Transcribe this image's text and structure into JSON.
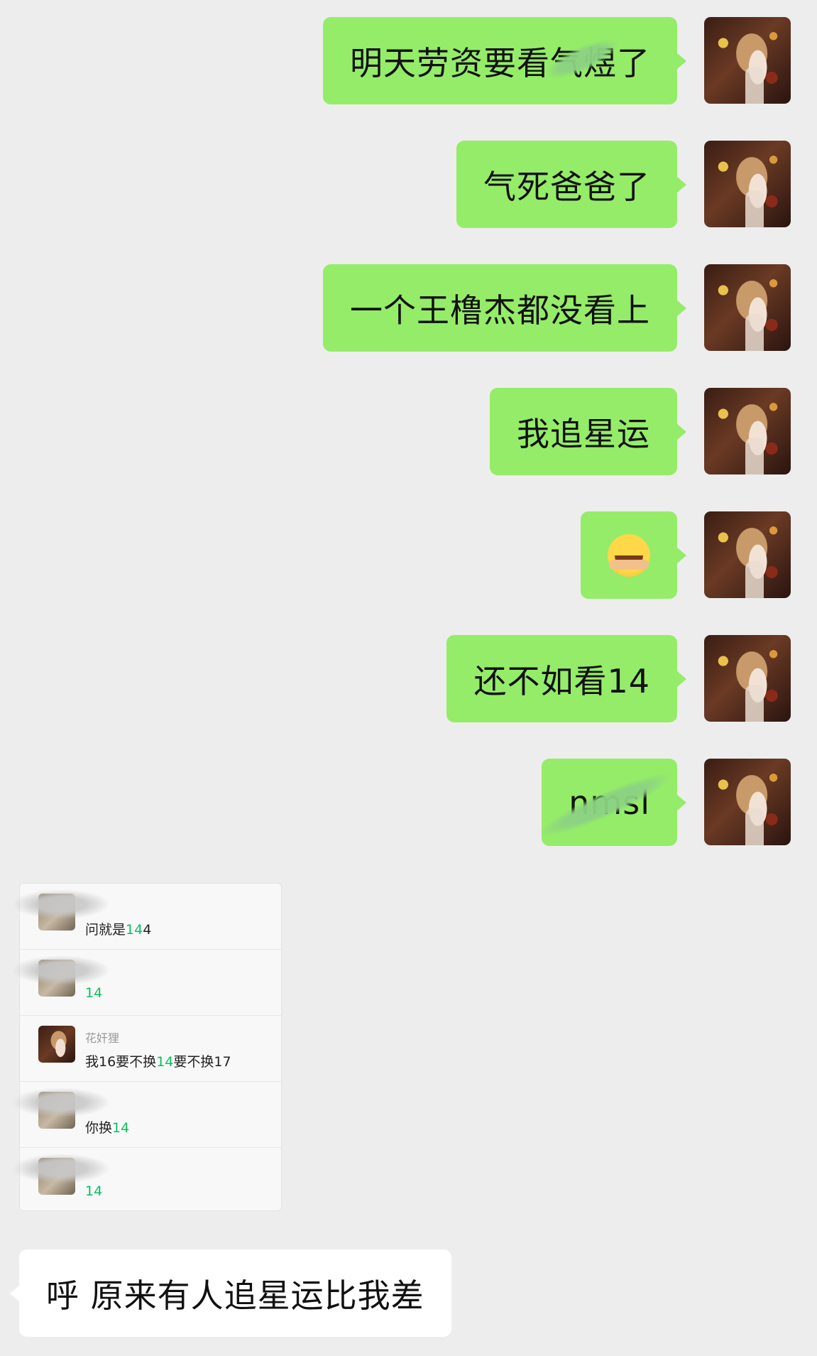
{
  "messages_out": [
    {
      "text": "明天劳资要看气煜了"
    },
    {
      "text": "气死爸爸了"
    },
    {
      "text": "一个王橹杰都没看上"
    },
    {
      "text": "我追星运"
    },
    {
      "text": "",
      "emoji": "crying-laughing-emoji"
    },
    {
      "text": "还不如看14"
    },
    {
      "text": "nmsl"
    }
  ],
  "quote_card": {
    "rows": [
      {
        "name": "",
        "pre": "问就是",
        "hl": "14",
        "post": "4"
      },
      {
        "name": "",
        "pre": "",
        "hl": "14",
        "post": ""
      },
      {
        "name": "花奸狸",
        "pre": "我16要不换",
        "hl": "14",
        "post": "要不换17"
      },
      {
        "name": "",
        "pre": "你换",
        "hl": "14",
        "post": ""
      },
      {
        "name": "",
        "pre": "",
        "hl": "14",
        "post": ""
      }
    ]
  },
  "message_in": {
    "text": "呼 原来有人追星运比我差"
  },
  "colors": {
    "outgoing_bubble": "#95ec69",
    "incoming_bubble": "#ffffff",
    "background": "#ededed",
    "highlight": "#07c160"
  }
}
